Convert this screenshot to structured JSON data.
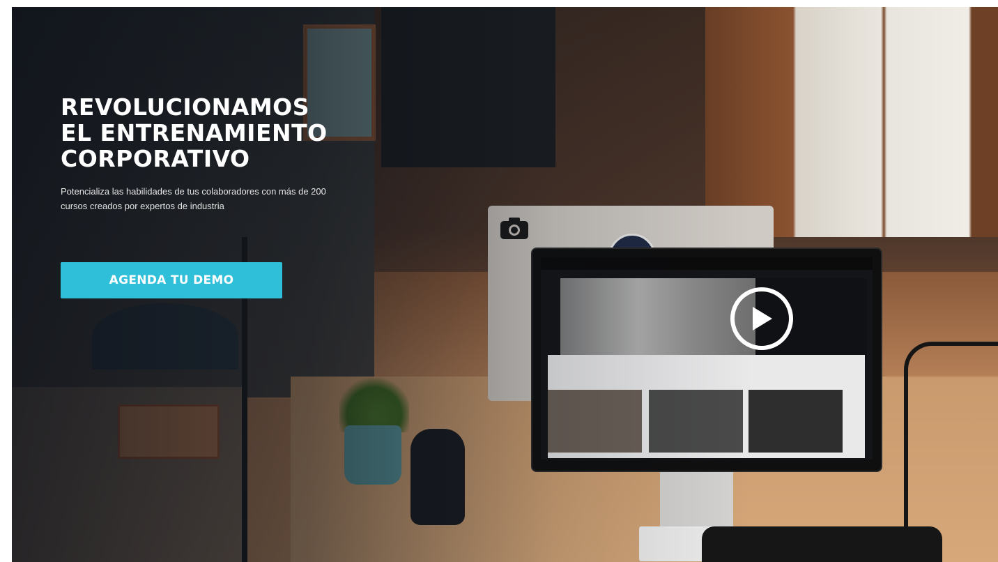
{
  "hero": {
    "headline_lines": [
      "REVOLUCIONAMOS",
      "EL ENTRENAMIENTO",
      "CORPORATIVO"
    ],
    "subtext": "Potencializa las habilidades de tus colaboradores con más de 200 cursos creados por expertos de industria",
    "cta_label": "AGENDA TU DEMO",
    "cta_color": "#2fbfd8"
  },
  "icons": {
    "play": "play-icon",
    "camera": "camera-icon"
  }
}
